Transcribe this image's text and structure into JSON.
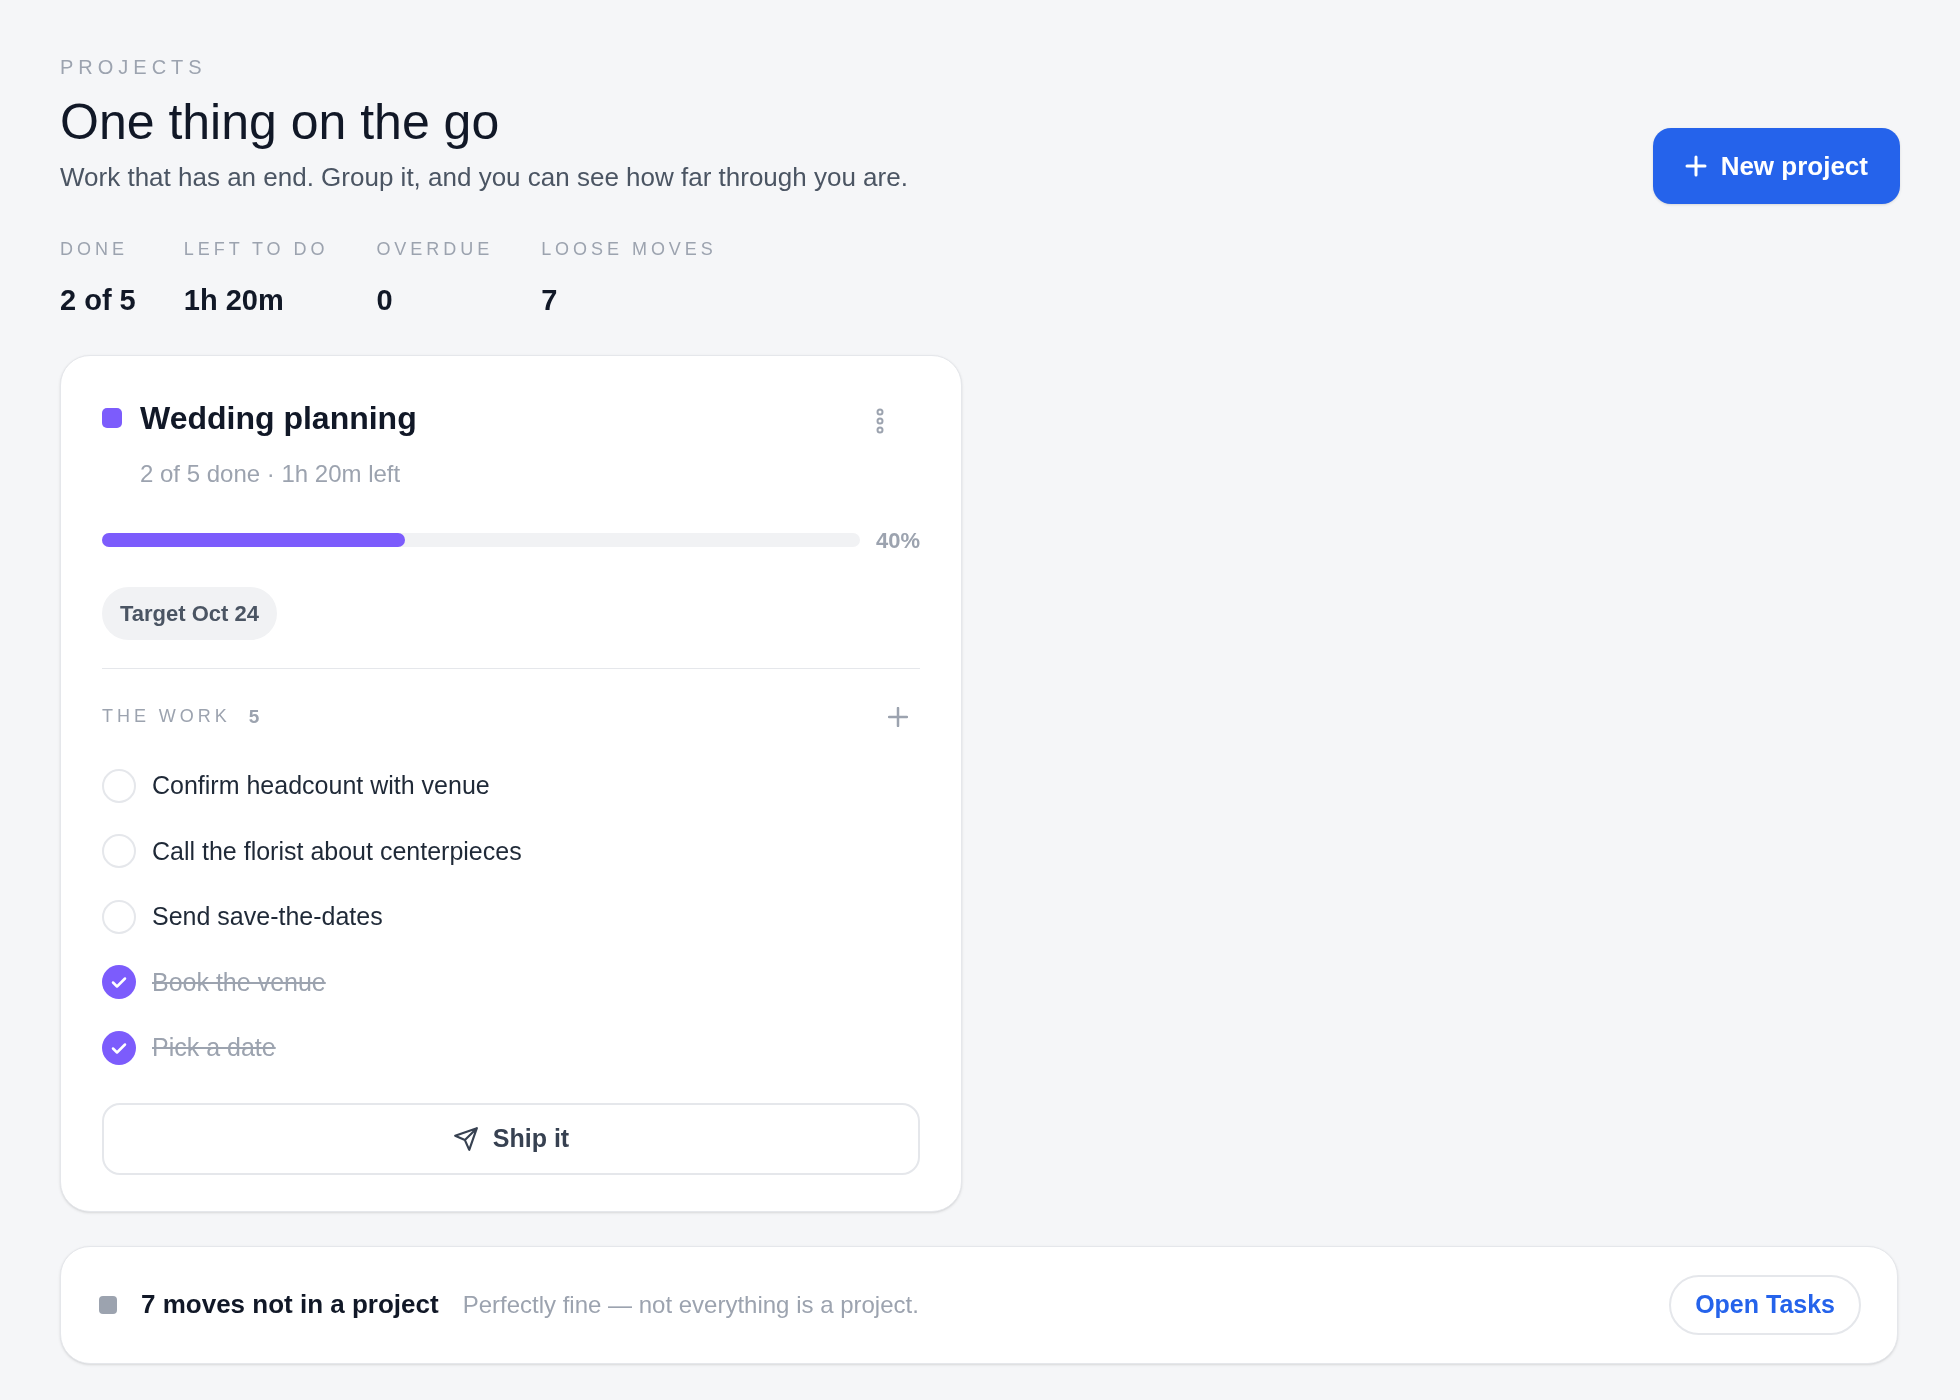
{
  "header": {
    "eyebrow": "PROJECTS",
    "title": "One thing on the go",
    "subtitle": "Work that has an end. Group it, and you can see how far through you are.",
    "new_button": "New project"
  },
  "stats": [
    {
      "label": "DONE",
      "value": "2 of 5"
    },
    {
      "label": "LEFT TO DO",
      "value": "1h 20m"
    },
    {
      "label": "OVERDUE",
      "value": "0"
    },
    {
      "label": "LOOSE MOVES",
      "value": "7"
    }
  ],
  "project": {
    "name": "Wedding planning",
    "color": "#7c5cfc",
    "meta": "2 of 5 done · 1h 20m left",
    "level": 0.4,
    "percent": "40%",
    "target": "Target Oct 24",
    "work_label": "THE WORK",
    "work_count": "5",
    "tasks": [
      {
        "text": "Confirm headcount with venue",
        "checked": false
      },
      {
        "text": "Call the florist about centerpieces",
        "checked": false
      },
      {
        "text": "Send save-the-dates",
        "checked": false
      },
      {
        "text": "Book the venue",
        "checked": true
      },
      {
        "text": "Pick a date",
        "checked": true
      }
    ],
    "ship_button": "Ship it"
  },
  "loose": {
    "title": "7 moves not in a project",
    "note": "Perfectly fine — not everything is a project.",
    "button": "Open Tasks"
  }
}
